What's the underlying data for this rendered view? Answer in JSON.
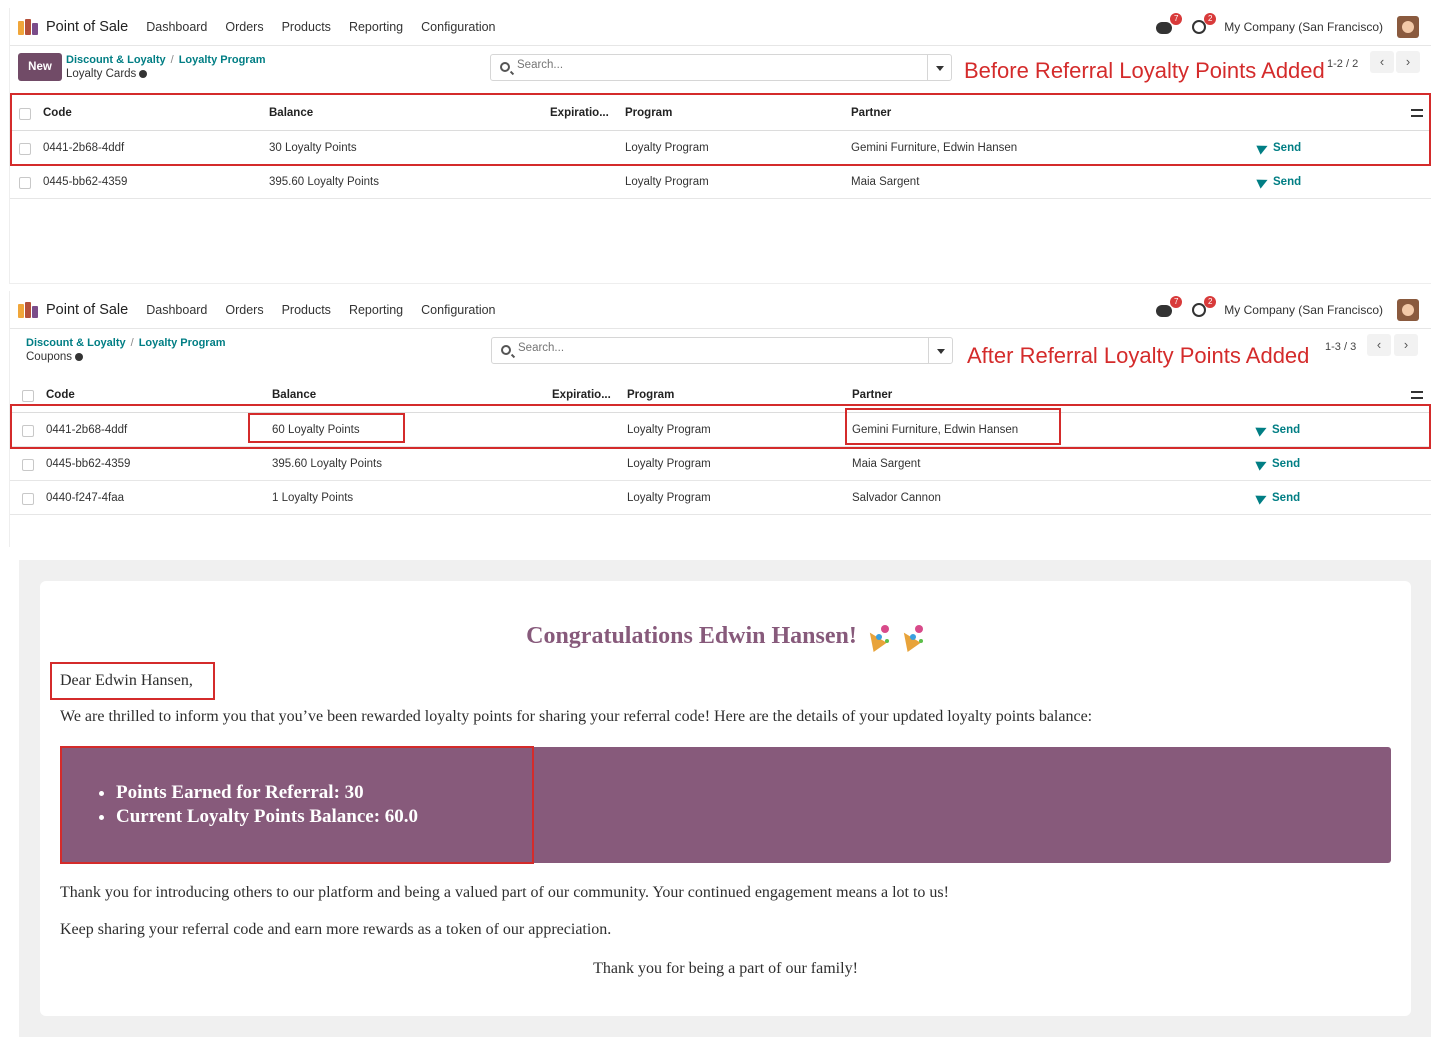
{
  "panels": [
    {
      "navbar": {
        "app_name": "Point of Sale",
        "menu": [
          "Dashboard",
          "Orders",
          "Products",
          "Reporting",
          "Configuration"
        ],
        "messages_count": "7",
        "activities_count": "2",
        "company": "My Company (San Francisco)"
      },
      "new_button": "New",
      "breadcrumb": [
        "Discount & Loyalty",
        "Loyalty Program"
      ],
      "subtitle": "Loyalty Cards",
      "search_placeholder": "Search...",
      "annotation": "Before Referral Loyalty Points Added",
      "pager": "1-2 / 2",
      "columns": [
        "Code",
        "Balance",
        "Expiratio...",
        "Program",
        "Partner"
      ],
      "rows": [
        {
          "code": "0441-2b68-4ddf",
          "balance": "30 Loyalty Points",
          "expiration": "",
          "program": "Loyalty Program",
          "partner": "Gemini Furniture, Edwin Hansen",
          "action": "Send"
        },
        {
          "code": "0445-bb62-4359",
          "balance": "395.60 Loyalty Points",
          "expiration": "",
          "program": "Loyalty Program",
          "partner": "Maia Sargent",
          "action": "Send"
        }
      ]
    },
    {
      "navbar": {
        "app_name": "Point of Sale",
        "menu": [
          "Dashboard",
          "Orders",
          "Products",
          "Reporting",
          "Configuration"
        ],
        "messages_count": "7",
        "activities_count": "2",
        "company": "My Company (San Francisco)"
      },
      "breadcrumb": [
        "Discount & Loyalty",
        "Loyalty Program"
      ],
      "subtitle": "Coupons",
      "search_placeholder": "Search...",
      "annotation": "After Referral Loyalty Points Added",
      "pager": "1-3 / 3",
      "columns": [
        "Code",
        "Balance",
        "Expiratio...",
        "Program",
        "Partner"
      ],
      "rows": [
        {
          "code": "0441-2b68-4ddf",
          "balance": "60 Loyalty Points",
          "expiration": "",
          "program": "Loyalty Program",
          "partner": "Gemini Furniture, Edwin Hansen",
          "action": "Send"
        },
        {
          "code": "0445-bb62-4359",
          "balance": "395.60 Loyalty Points",
          "expiration": "",
          "program": "Loyalty Program",
          "partner": "Maia Sargent",
          "action": "Send"
        },
        {
          "code": "0440-f247-4faa",
          "balance": "1 Loyalty Points",
          "expiration": "",
          "program": "Loyalty Program",
          "partner": "Salvador Cannon",
          "action": "Send"
        }
      ]
    }
  ],
  "email": {
    "title": "Congratulations Edwin Hansen!",
    "greeting": "Dear Edwin Hansen,",
    "intro": "We are thrilled to inform you that you’ve been rewarded loyalty points for sharing your referral code! Here are the details of your updated loyalty points balance:",
    "points": [
      "Points Earned for Referral: 30",
      "Current Loyalty Points Balance: 60.0"
    ],
    "para1": "Thank you for introducing others to our platform and being a valued part of our community. Your continued engagement means a lot to us!",
    "para2": "Keep sharing your referral code and earn more rewards as a token of our appreciation.",
    "closing": "Thank you for being a part of our family!"
  },
  "colors": {
    "brand": "#714b67",
    "accent": "#017e84",
    "annotation_red": "#d42b2b",
    "email_purple": "#875a7b"
  }
}
